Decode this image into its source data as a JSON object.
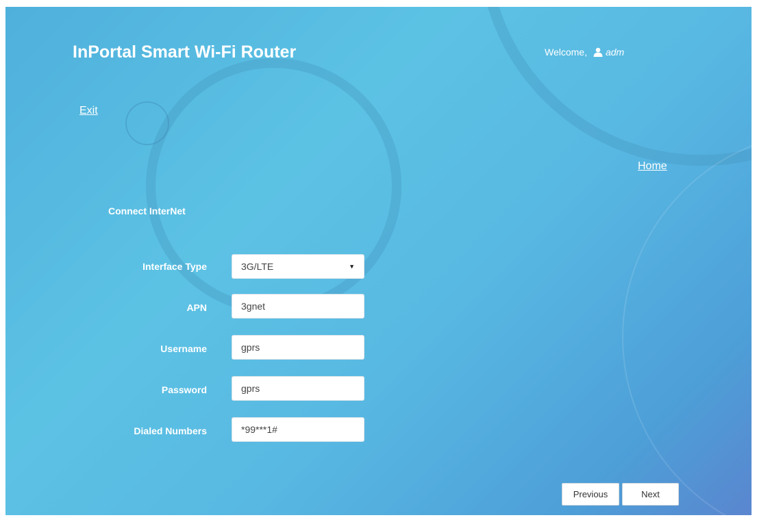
{
  "header": {
    "title": "InPortal Smart Wi-Fi Router",
    "welcome_text": "Welcome,",
    "username": "adm",
    "user_icon": "user-icon"
  },
  "nav": {
    "exit_label": "Exit",
    "home_label": "Home"
  },
  "section": {
    "title": "Connect InterNet"
  },
  "form": {
    "interface_type": {
      "label": "Interface Type",
      "value": "3G/LTE"
    },
    "apn": {
      "label": "APN",
      "value": "3gnet"
    },
    "username": {
      "label": "Username",
      "value": "gprs"
    },
    "password": {
      "label": "Password",
      "value": "gprs"
    },
    "dialed_numbers": {
      "label": "Dialed Numbers",
      "value": "*99***1#"
    }
  },
  "buttons": {
    "previous_label": "Previous",
    "next_label": "Next"
  }
}
